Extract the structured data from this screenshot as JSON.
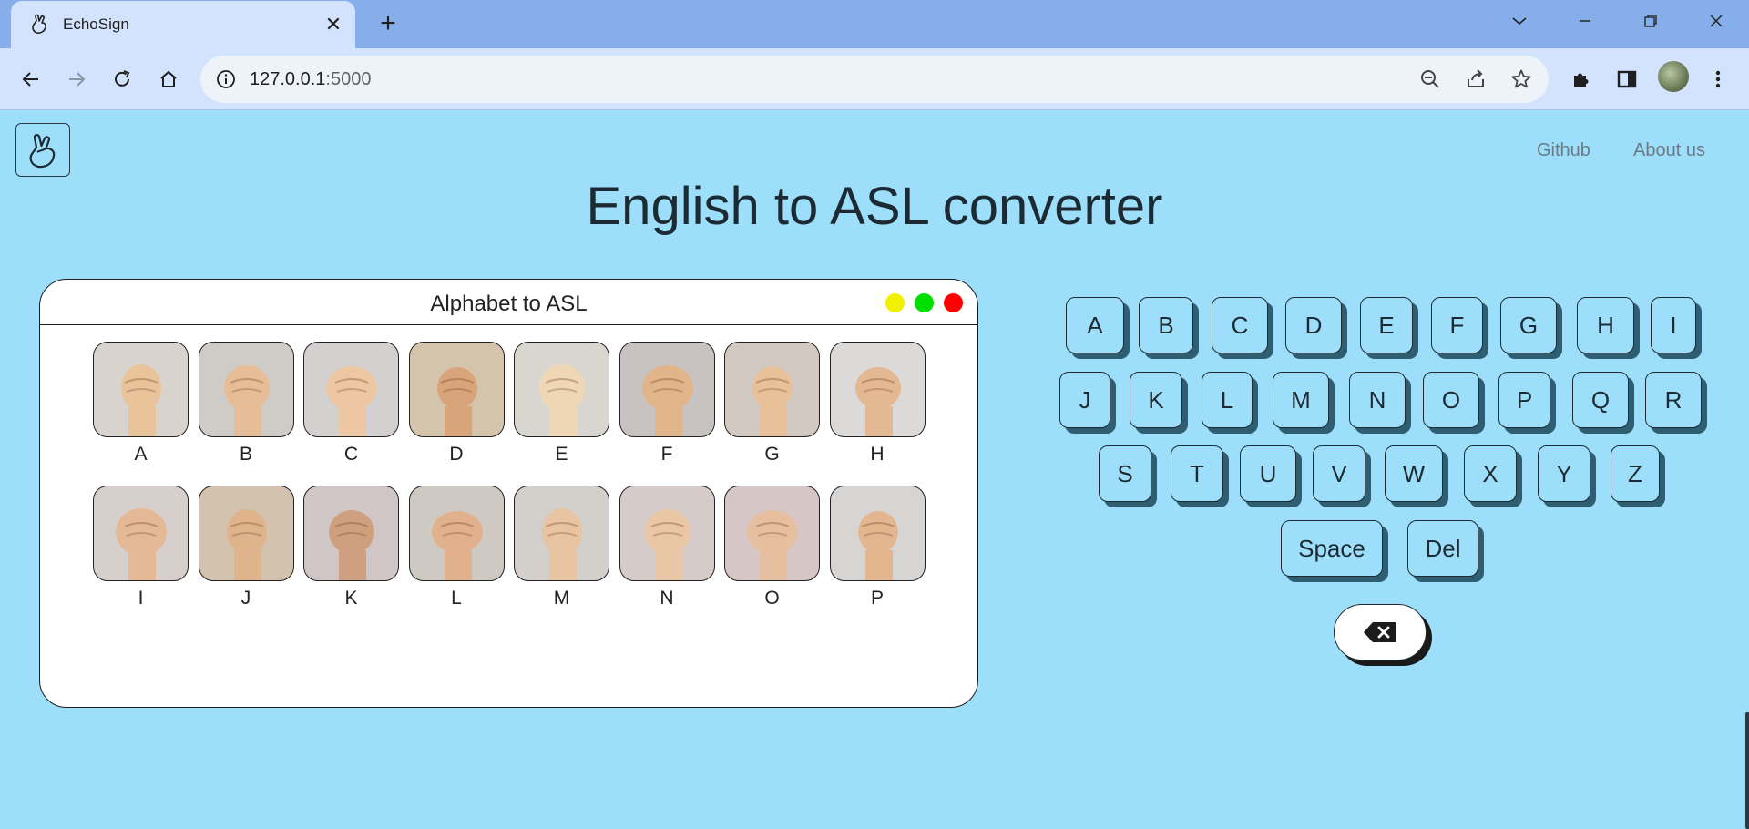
{
  "browser": {
    "tab_title": "EchoSign",
    "url_host": "127.0.0.1",
    "url_port": ":5000",
    "icons": [
      "back-icon",
      "forward-icon",
      "reload-icon",
      "home-icon",
      "site-info-icon",
      "zoom-out-icon",
      "share-icon",
      "bookmark-star-icon",
      "extensions-icon",
      "side-panel-icon",
      "profile-avatar",
      "more-menu-icon"
    ]
  },
  "nav": {
    "github": "Github",
    "about": "About us"
  },
  "page": {
    "heading": "English to ASL converter"
  },
  "panel": {
    "title": "Alphabet to ASL",
    "dot_colors": [
      "#f0f000",
      "#00e000",
      "#ff0000"
    ],
    "letters": [
      "A",
      "B",
      "C",
      "D",
      "E",
      "F",
      "G",
      "H",
      "I",
      "J",
      "K",
      "L",
      "M",
      "N",
      "O",
      "P"
    ]
  },
  "keyboard": {
    "row1": [
      "A",
      "B",
      "C",
      "D",
      "E",
      "F",
      "G",
      "H",
      "I"
    ],
    "row2": [
      "J",
      "K",
      "L",
      "M",
      "N",
      "O",
      "P",
      "Q",
      "R"
    ],
    "row3": [
      "S",
      "T",
      "U",
      "V",
      "W",
      "X",
      "Y",
      "Z"
    ],
    "row4": [
      "Space",
      "Del"
    ],
    "backspace_icon": "backspace-icon"
  },
  "colors": {
    "page_bg": "#9ddffb",
    "key_shadow": "#2f5d72"
  }
}
